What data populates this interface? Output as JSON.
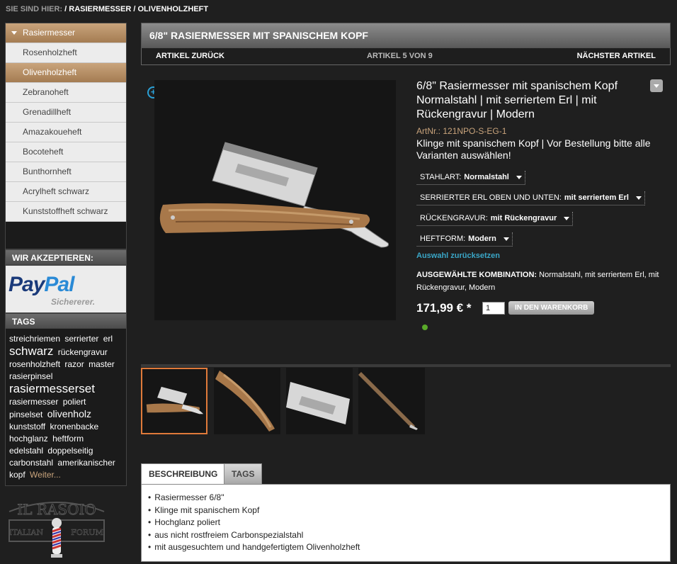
{
  "breadcrumb": {
    "prefix": "SIE SIND HIER:",
    "sep": " / ",
    "items": [
      "RASIERMESSER",
      "OLIVENHOLZHEFT"
    ]
  },
  "sidebar": {
    "categories": [
      {
        "label": "Rasiermesser",
        "type": "top"
      },
      {
        "label": "Rosenholzheft",
        "type": "sub"
      },
      {
        "label": "Olivenholzheft",
        "type": "active"
      },
      {
        "label": "Zebranoheft",
        "type": "sub"
      },
      {
        "label": "Grenadillheft",
        "type": "sub"
      },
      {
        "label": "Amazakoueheft",
        "type": "sub"
      },
      {
        "label": "Bocoteheft",
        "type": "sub"
      },
      {
        "label": "Bunthornheft",
        "type": "sub"
      },
      {
        "label": "Acrylheft schwarz",
        "type": "sub"
      },
      {
        "label": "Kunststoffheft schwarz",
        "type": "sub"
      }
    ],
    "accept_title": "WIR AKZEPTIEREN:",
    "paypal": {
      "part1": "Pay",
      "part2": "Pal",
      "sub": "Sichererer."
    },
    "tags_title": "TAGS",
    "tags": [
      {
        "text": "streichriemen",
        "size": "sm"
      },
      {
        "text": "serrierter",
        "size": "sm"
      },
      {
        "text": "erl",
        "size": "sm"
      },
      {
        "text": "schwarz",
        "size": "lg"
      },
      {
        "text": "rückengravur",
        "size": "sm"
      },
      {
        "text": "rosenholzheft",
        "size": "sm"
      },
      {
        "text": "razor",
        "size": "sm"
      },
      {
        "text": "master",
        "size": "sm"
      },
      {
        "text": "rasierpinsel",
        "size": "sm"
      },
      {
        "text": "rasiermesserset",
        "size": "lg"
      },
      {
        "text": "rasiermesser",
        "size": "sm"
      },
      {
        "text": "poliert",
        "size": "sm"
      },
      {
        "text": "pinselset",
        "size": "sm"
      },
      {
        "text": "olivenholz",
        "size": "md"
      },
      {
        "text": "kunststoff",
        "size": "sm"
      },
      {
        "text": "kronenbacke",
        "size": "sm"
      },
      {
        "text": "hochglanz",
        "size": "sm"
      },
      {
        "text": "heftform",
        "size": "sm"
      },
      {
        "text": "edelstahl",
        "size": "sm"
      },
      {
        "text": "doppelseitig",
        "size": "sm"
      },
      {
        "text": "carbonstahl",
        "size": "sm"
      },
      {
        "text": "amerikanischer",
        "size": "sm"
      },
      {
        "text": "kopf",
        "size": "sm"
      }
    ],
    "tags_more": "Weiter...",
    "logo": {
      "line1": "IL RASOIO",
      "line2": "ITALIAN",
      "line3": "FORUM"
    }
  },
  "product": {
    "header_title": "6/8\" RASIERMESSER MIT SPANISCHEM KOPF",
    "nav_prev": "ARTIKEL ZURÜCK",
    "nav_count": "ARTIKEL 5 VON 9",
    "nav_next": "NÄCHSTER ARTIKEL",
    "title": "6/8\" Rasiermesser mit spanischem Kopf Normalstahl | mit serriertem Erl | mit Rückengravur | Modern",
    "artnr_label": "ArtNr.:",
    "artnr": "121NPO-S-EG-1",
    "description": "Klinge mit spanischem Kopf | Vor Bestellung bitte alle Varianten auswählen!",
    "variants": [
      {
        "label": "STAHLART:",
        "value": "Normalstahl"
      },
      {
        "label": "SERRIERTER ERL OBEN UND UNTEN:",
        "value": "mit serriertem Erl"
      },
      {
        "label": "RÜCKENGRAVUR:",
        "value": "mit Rückengravur"
      },
      {
        "label": "HEFTFORM:",
        "value": "Modern"
      }
    ],
    "reset_label": "Auswahl zurücksetzen",
    "combo_label": "AUSGEWÄHLTE KOMBINATION:",
    "combo_value": "Normalstahl, mit serriertem Erl, mit Rückengravur, Modern",
    "price": "171,99 € *",
    "qty": "1",
    "cart_label": "IN DEN WARENKORB",
    "colors": {
      "accent": "#c9a47c",
      "link": "#3aa6c7",
      "stock": "#5aaa2a",
      "thumb_selected": "#e07a3a"
    }
  },
  "tabs": {
    "items": [
      "BESCHREIBUNG",
      "TAGS"
    ],
    "description_list": [
      "Rasiermesser 6/8\"",
      "Klinge mit spanischem Kopf",
      "Hochglanz poliert",
      "aus nicht rostfreiem Carbonspezialstahl",
      "mit ausgesuchtem und handgefertigtem Olivenholzheft"
    ]
  }
}
